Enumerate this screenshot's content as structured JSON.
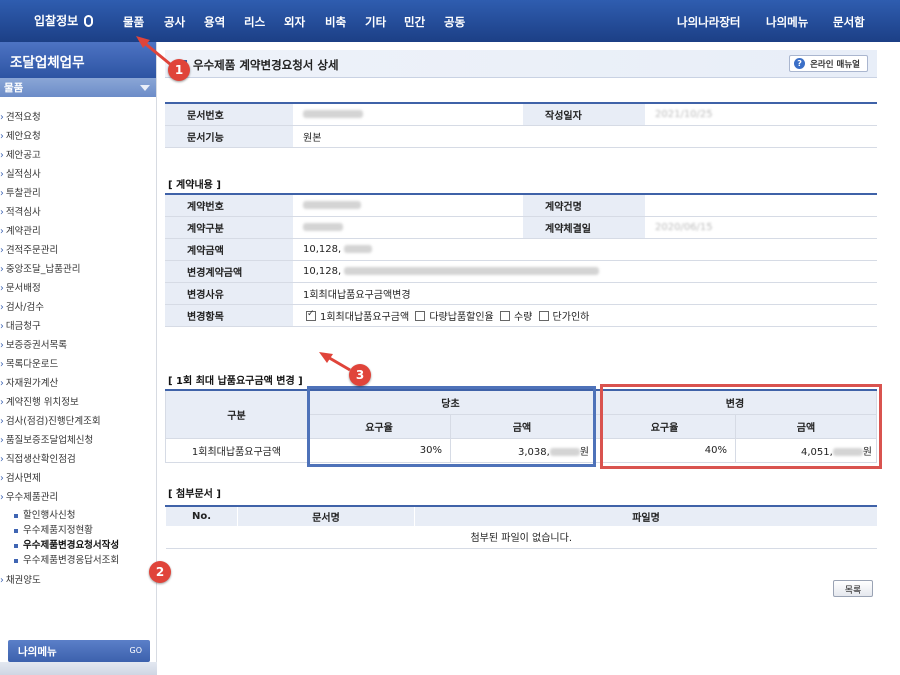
{
  "topnav": {
    "bid_info": "입찰정보",
    "menus": [
      "물품",
      "공사",
      "용역",
      "리스",
      "외자",
      "비축",
      "기타",
      "민간",
      "공동"
    ],
    "right_menus": [
      "나의나라장터",
      "나의메뉴",
      "문서함"
    ]
  },
  "sidebar": {
    "title": "조달업체업무",
    "subtitle": "물품",
    "items": [
      "견적요청",
      "제안요청",
      "제안공고",
      "실적심사",
      "투찰관리",
      "적격심사",
      "계약관리",
      "견적주문관리",
      "중앙조달_납품관리",
      "문서배정",
      "검사/검수",
      "대금청구",
      "보증증권서목록",
      "목록다운로드",
      "자재원가계산",
      "계약진행 위치정보",
      "검사(점검)진행단계조회",
      "품질보증조달업체신청",
      "직접생산확인점검",
      "검사면제",
      "우수제품관리"
    ],
    "subitems": [
      "할인행사신청",
      "우수제품지정현황",
      "우수제품변경요청서작성",
      "우수제품변경응답서조회"
    ],
    "last_item": "채권양도",
    "my_menu": "나의메뉴",
    "go": "GO"
  },
  "page": {
    "title": "우수제품 계약변경요청서 상세",
    "manual": "온라인 매뉴얼"
  },
  "doc": {
    "doc_no_label": "문서번호",
    "date_label": "작성일자",
    "date_value": "2021/10/25",
    "func_label": "문서기능",
    "func_value": "원본"
  },
  "contract": {
    "section": "[ 계약내용 ]",
    "no_label": "계약번호",
    "name_label": "계약건명",
    "type_label": "계약구분",
    "sign_label": "계약체결일",
    "sign_value": "2020/06/15",
    "amount_label": "계약금액",
    "amount_value": "10,128,",
    "changed_label": "변경계약금액",
    "changed_value": "10,128,",
    "reason_label": "변경사유",
    "reason_value": "1회최대납품요구금액변경",
    "items_label": "변경항목",
    "items": [
      {
        "label": "1회최대납품요구금액",
        "checked": true
      },
      {
        "label": "다량납품할인율",
        "checked": false
      },
      {
        "label": "수량",
        "checked": false
      },
      {
        "label": "단가인하",
        "checked": false
      }
    ]
  },
  "change": {
    "section": "[ 1회 최대 납품요구금액 변경 ]",
    "col_div": "구분",
    "before": "당초",
    "after": "변경",
    "rate": "요구율",
    "amount": "금액",
    "row_label": "1회최대납품요구금액",
    "before_rate": "30%",
    "before_amount": "3,038,",
    "after_rate": "40%",
    "after_amount": "4,051,",
    "won": "원"
  },
  "attach": {
    "section": "[ 첨부문서 ]",
    "col_no": "No.",
    "col_doc": "문서명",
    "col_file": "파일명",
    "empty": "첨부된 파일이 없습니다."
  },
  "list_button": "목록",
  "badges": [
    "1",
    "2",
    "3"
  ]
}
